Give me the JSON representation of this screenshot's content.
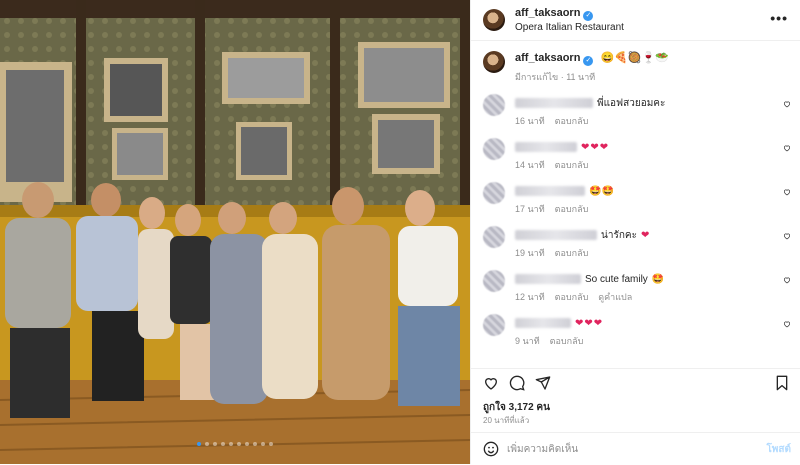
{
  "post": {
    "username": "aff_taksaorn",
    "location": "Opera Italian Restaurant",
    "caption_emojis": "😄🍕🥘🍷🥗",
    "edited_label": "มีการแก้ไข",
    "edited_time": "11 นาที",
    "more_label": "•••"
  },
  "comments": [
    {
      "text": "พี่แอฟสวยอมคะ",
      "time": "16 นาที",
      "reply": "ตอบกลับ",
      "extra": ""
    },
    {
      "text": "",
      "hearts": "❤❤❤",
      "time": "14 นาที",
      "reply": "ตอบกลับ",
      "extra": ""
    },
    {
      "text": "",
      "emoji": "🤩🤩",
      "time": "17 นาที",
      "reply": "ตอบกลับ",
      "extra": ""
    },
    {
      "text": "น่ารักคะ",
      "hearts": "❤",
      "time": "19 นาที",
      "reply": "ตอบกลับ",
      "extra": ""
    },
    {
      "text": "So cute family",
      "emoji": "🤩",
      "time": "12 นาที",
      "reply": "ตอบกลับ",
      "extra": "ดูคำแปล"
    },
    {
      "text": "",
      "hearts": "❤❤❤",
      "time": "9 นาที",
      "reply": "ตอบกลับ",
      "extra": ""
    }
  ],
  "likes_label": "ถูกใจ 3,172 คน",
  "time_ago": "20 นาทีที่แล้ว",
  "add_comment": {
    "placeholder": "เพิ่มความคิดเห็น",
    "post_label": "โพสต์"
  },
  "carousel": {
    "count": 10,
    "active": 0
  },
  "colors": {
    "accent": "#3897f0",
    "heart": "#e0245e",
    "muted": "#8e8e8e"
  }
}
